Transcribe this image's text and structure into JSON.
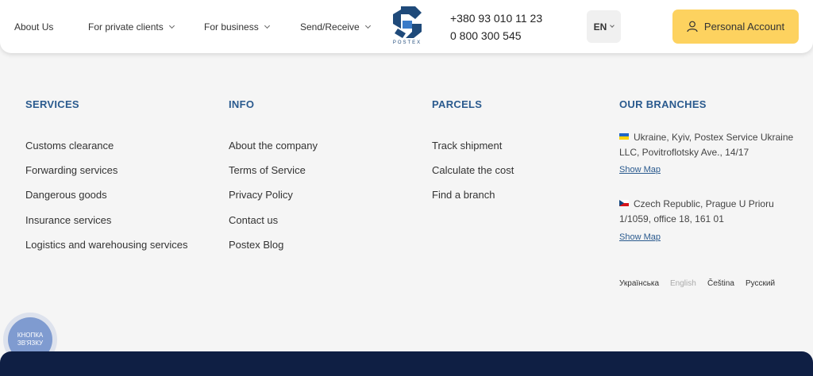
{
  "header": {
    "nav": [
      {
        "label": "About Us"
      },
      {
        "label": "For private clients"
      },
      {
        "label": "For business"
      },
      {
        "label": "Send/Receive"
      }
    ],
    "logo_text": "POSTEX",
    "phones": [
      "+380 93 010 11 23",
      "0 800 300 545"
    ],
    "language": "EN",
    "account_label": "Personal Account"
  },
  "footer": {
    "services": {
      "title": "SERVICES",
      "links": [
        "Customs clearance",
        "Forwarding services",
        "Dangerous goods",
        "Insurance services",
        "Logistics and warehousing services"
      ]
    },
    "info": {
      "title": "INFO",
      "links": [
        "About the company",
        "Terms of Service",
        "Privacy Policy",
        "Contact us",
        "Postex Blog"
      ]
    },
    "parcels": {
      "title": "PARCELS",
      "links": [
        "Track shipment",
        "Calculate the cost",
        "Find a branch"
      ]
    },
    "branches": {
      "title": "OUR BRANCHES",
      "items": [
        {
          "address": "Ukraine, Kyiv, Postex Service Ukraine LLC, Povitroflotsky Ave., 14/17",
          "map_label": "Show Map"
        },
        {
          "address": "Czech Republic, Prague U Prioru 1/1059, office 18, 161 01",
          "map_label": "Show Map"
        }
      ]
    },
    "languages": [
      "Українська",
      "English",
      "Čeština",
      "Русский"
    ]
  },
  "float_button": {
    "label": "КНОПКА ЗВ'ЯЗКУ"
  },
  "colors": {
    "accent": "#2a5a8e",
    "button": "#fdd25f",
    "dark_band": "#0f1f44"
  }
}
